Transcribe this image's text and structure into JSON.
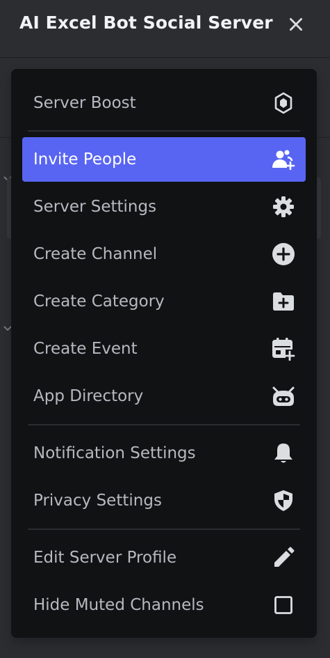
{
  "header": {
    "server_name": "AI Excel Bot Social Server"
  },
  "menu": {
    "server_boost": "Server Boost",
    "invite_people": "Invite People",
    "server_settings": "Server Settings",
    "create_channel": "Create Channel",
    "create_category": "Create Category",
    "create_event": "Create Event",
    "app_directory": "App Directory",
    "notification_settings": "Notification Settings",
    "privacy_settings": "Privacy Settings",
    "edit_server_profile": "Edit Server Profile",
    "hide_muted_channels": "Hide Muted Channels"
  },
  "icons": {
    "server_boost": "boost-gem-icon",
    "invite_people": "person-add-icon",
    "server_settings": "gear-icon",
    "create_channel": "plus-circle-icon",
    "create_category": "folder-plus-icon",
    "create_event": "calendar-plus-icon",
    "app_directory": "robot-icon",
    "notification_settings": "bell-icon",
    "privacy_settings": "shield-icon",
    "edit_server_profile": "pencil-icon",
    "hide_muted_channels": "checkbox-icon",
    "close": "close-icon"
  },
  "state": {
    "highlighted_item": "invite_people",
    "hide_muted_channels_checked": false
  },
  "colors": {
    "accent": "#5865f2",
    "menu_bg": "#111214",
    "page_bg": "#2b2d31",
    "text": "#b5bac1",
    "icon": "#dbdee1"
  }
}
